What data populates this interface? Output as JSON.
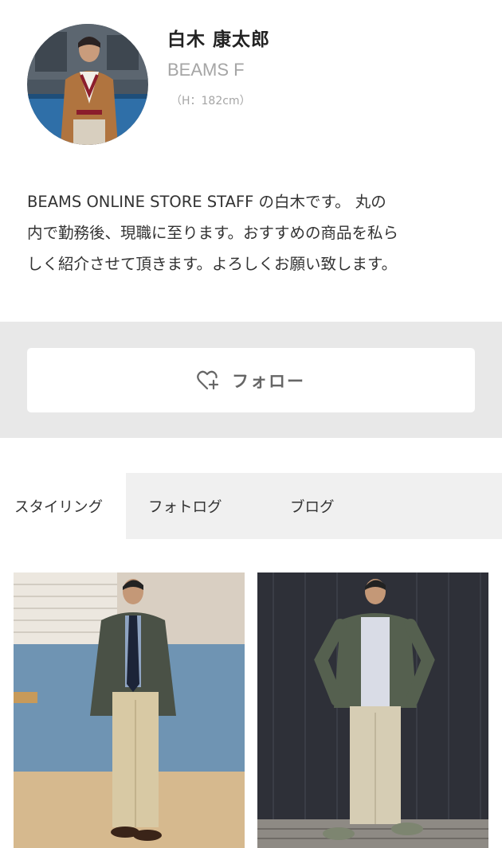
{
  "profile": {
    "name": "白木 康太郎",
    "brand": "BEAMS F",
    "height": "（H：182cm）"
  },
  "bio": {
    "lines": [
      "BEAMS ONLINE STORE STAFF の白木です。 丸の",
      "内で勤務後、現職に至ります。おすすめの商品を私ら",
      "しく紹介させて頂きます。よろしくお願い致します。"
    ]
  },
  "follow": {
    "label": "フォロー",
    "icon": "heart-plus-icon"
  },
  "tabs": [
    {
      "label": "スタイリング",
      "active": true
    },
    {
      "label": "フォトログ",
      "active": false
    },
    {
      "label": "ブログ",
      "active": false
    }
  ],
  "colors": {
    "background": "#ffffff",
    "band": "#e8e8e8",
    "tab_bar": "#f0f0f0",
    "muted_text": "#a5a5a5",
    "body_text": "#333333"
  }
}
